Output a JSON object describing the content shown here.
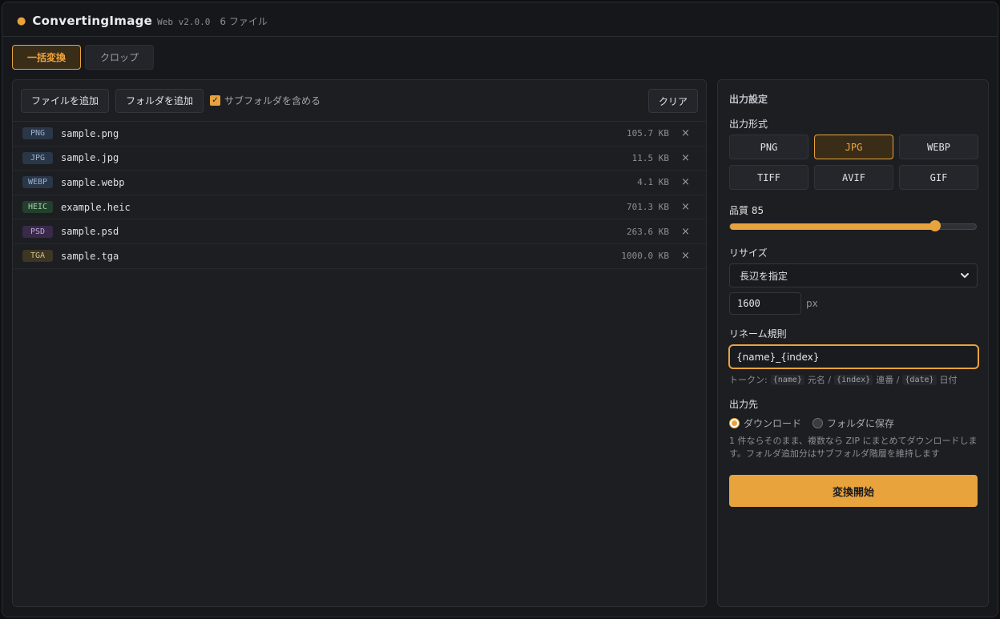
{
  "app": {
    "name": "ConvertingImage",
    "version": "Web v2.0.0",
    "file_count": "6 ファイル"
  },
  "tabs": [
    {
      "label": "一括変換",
      "active": true
    },
    {
      "label": "クロップ",
      "active": false
    }
  ],
  "toolbar": {
    "add_file": "ファイルを追加",
    "add_folder": "フォルダを追加",
    "include_subfolders": "サブフォルダを含める",
    "include_subfolders_checked": true,
    "clear": "クリア"
  },
  "files": [
    {
      "type": "PNG",
      "name": "sample.png",
      "size": "105.7 KB",
      "badge_bg": "#2a3748",
      "badge_fg": "#9ab2cf"
    },
    {
      "type": "JPG",
      "name": "sample.jpg",
      "size": "11.5 KB",
      "badge_bg": "#2a3748",
      "badge_fg": "#9ab2cf"
    },
    {
      "type": "WEBP",
      "name": "sample.webp",
      "size": "4.1 KB",
      "badge_bg": "#2a3748",
      "badge_fg": "#9ab2cf"
    },
    {
      "type": "HEIC",
      "name": "example.heic",
      "size": "701.3 KB",
      "badge_bg": "#23402c",
      "badge_fg": "#9fd0a7"
    },
    {
      "type": "PSD",
      "name": "sample.psd",
      "size": "263.6 KB",
      "badge_bg": "#3a2a4a",
      "badge_fg": "#c3a6dd"
    },
    {
      "type": "TGA",
      "name": "sample.tga",
      "size": "1000.0 KB",
      "badge_bg": "#3d3622",
      "badge_fg": "#cdbd8f"
    }
  ],
  "remove_glyph": "×",
  "settings": {
    "title": "出力設定",
    "format_label": "出力形式",
    "formats": [
      {
        "label": "PNG",
        "active": false
      },
      {
        "label": "JPG",
        "active": true
      },
      {
        "label": "WEBP",
        "active": false
      },
      {
        "label": "TIFF",
        "active": false
      },
      {
        "label": "AVIF",
        "active": false
      },
      {
        "label": "GIF",
        "active": false
      }
    ],
    "quality_label": "品質",
    "quality_value": "85",
    "quality_fraction": 0.833,
    "resize_label": "リサイズ",
    "resize_mode": "長辺を指定",
    "resize_value": "1600",
    "resize_unit": "px",
    "rename_label": "リネーム規則",
    "rename_value": "{name}_{index}",
    "token_prefix": "トークン:",
    "tokens": [
      {
        "code": "{name}",
        "desc": "元名 /"
      },
      {
        "code": "{index}",
        "desc": "連番 /"
      },
      {
        "code": "{date}",
        "desc": "日付"
      }
    ],
    "destination_label": "出力先",
    "destinations": [
      {
        "label": "ダウンロード",
        "selected": true
      },
      {
        "label": "フォルダに保存",
        "selected": false
      }
    ],
    "description": "1 件ならそのまま、複数なら ZIP にまとめてダウンロードします。フォルダ追加分はサブフォルダ階層を維持します",
    "start_label": "変換開始"
  },
  "colors": {
    "accent": "#e8a33c",
    "background": "#17181c",
    "panel": "#1d1e22"
  }
}
